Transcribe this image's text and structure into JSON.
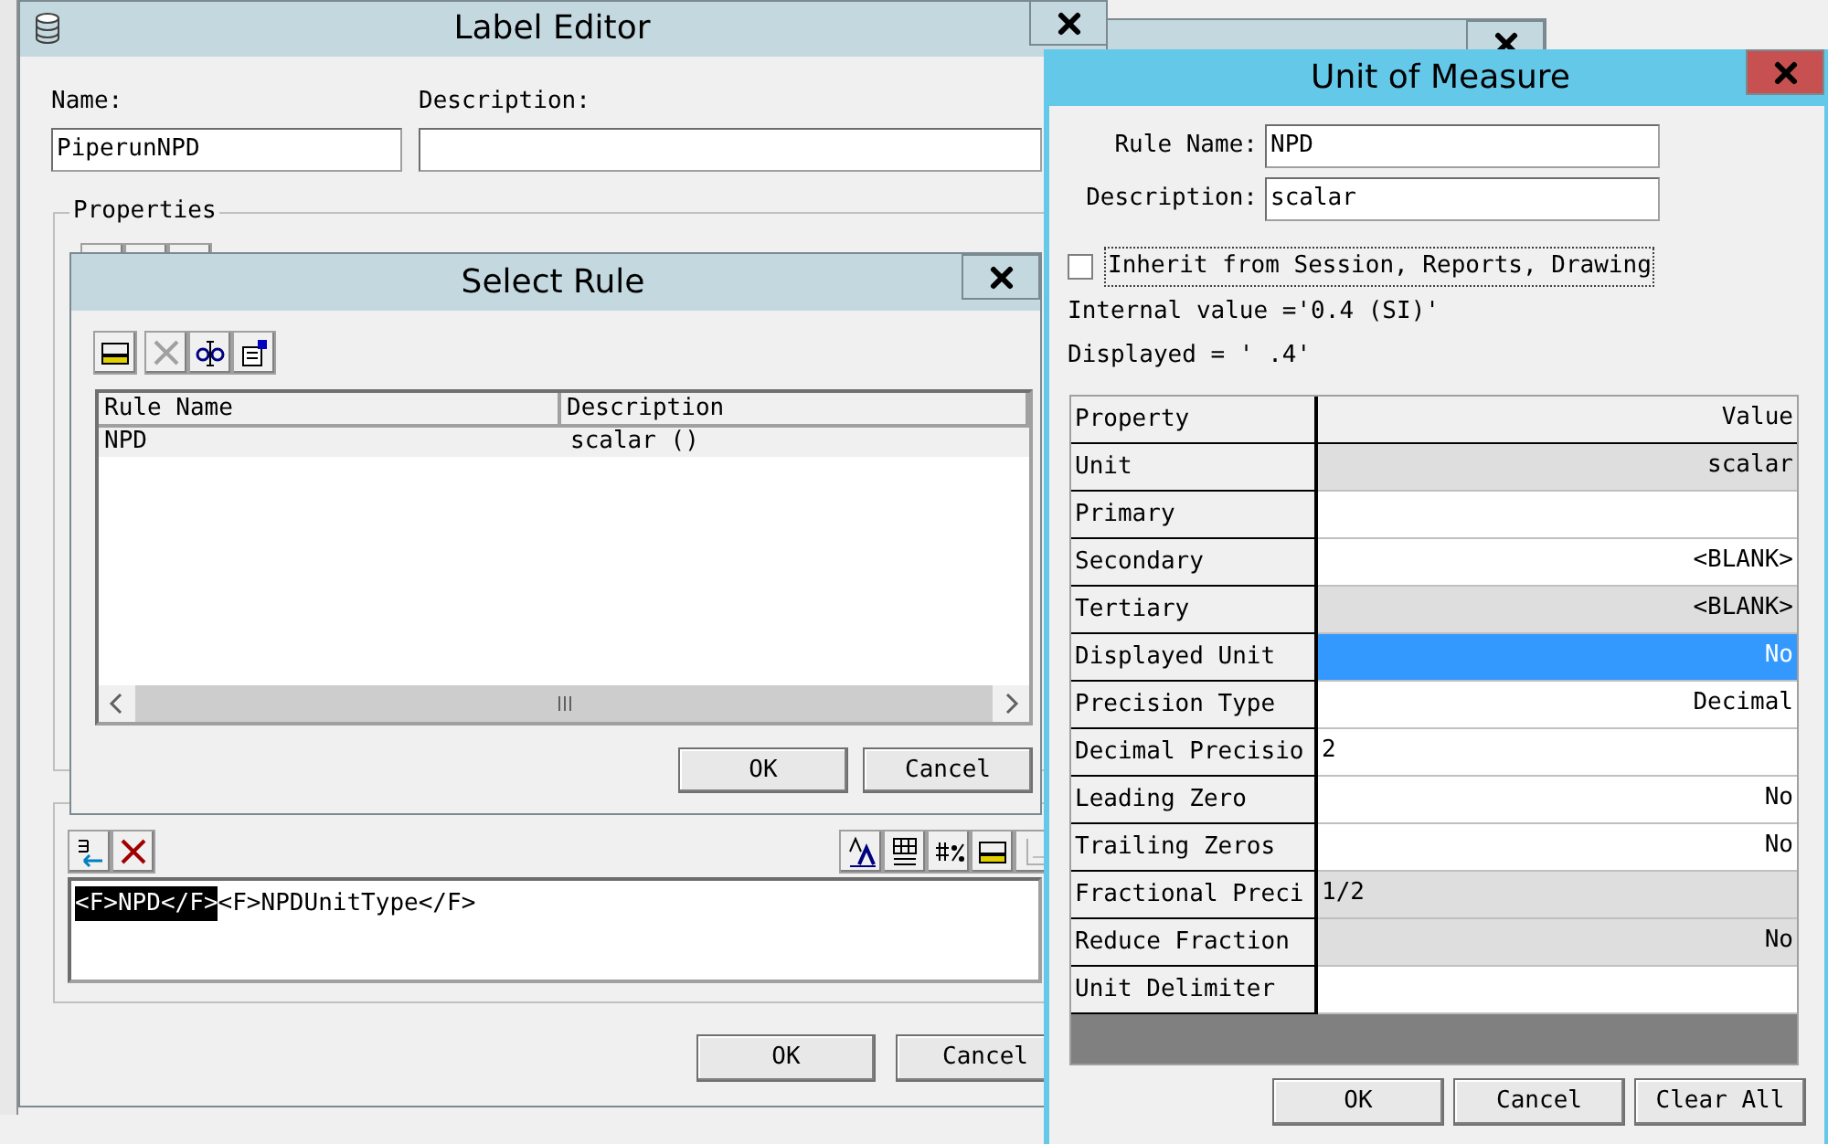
{
  "label_editor": {
    "title": "Label Editor",
    "name_label": "Name:",
    "name_value": "PiperunNPD",
    "description_label": "Description:",
    "properties_label": "Properties",
    "format_segments": [
      {
        "text": "<F>NPD</F>",
        "selected": true
      },
      {
        "text": "<F>NPDUnitType</F>",
        "selected": false
      }
    ],
    "buttons": [
      "OK",
      "Cancel"
    ]
  },
  "select_rule": {
    "title": "Select Rule",
    "columns": [
      "Rule Name",
      "Description"
    ],
    "rows": [
      {
        "cells": [
          "NPD",
          "scalar ()"
        ],
        "selected": true
      }
    ],
    "buttons": [
      "OK",
      "Cancel"
    ]
  },
  "unit_of_measure": {
    "title": "Unit of Measure",
    "rule_name_label": "Rule Name:",
    "rule_name_value": "NPD",
    "description_label": "Description:",
    "description_value": "scalar",
    "inherit": {
      "label": "Inherit from Session, Reports, Drawing",
      "checked": false
    },
    "internal_value": "Internal value ='0.4 (SI)'",
    "displayed": "Displayed = ' .4'",
    "columns": [
      "Property",
      "Value"
    ],
    "rows": [
      {
        "property": "Unit",
        "value": "scalar",
        "kind": "choice",
        "editable": false,
        "selected": false
      },
      {
        "property": "Primary",
        "kind": "choice",
        "editable": true,
        "selected": false
      },
      {
        "property": "Secondary",
        "value": "<BLANK>",
        "kind": "choice",
        "editable": true,
        "selected": false
      },
      {
        "property": "Tertiary",
        "value": "<BLANK>",
        "kind": "choice",
        "editable": false,
        "selected": false
      },
      {
        "property": "Displayed Unit",
        "value": "No",
        "kind": "choice",
        "selected": true
      },
      {
        "property": "Precision Type",
        "value": "Decimal",
        "kind": "choice",
        "editable": true,
        "selected": false
      },
      {
        "property": "Decimal Precisio",
        "value": "2",
        "kind": "number",
        "editable": true,
        "selected": false
      },
      {
        "property": "Leading Zero",
        "value": "No",
        "kind": "choice",
        "editable": true,
        "selected": false
      },
      {
        "property": "Trailing Zeros",
        "value": "No",
        "kind": "choice",
        "editable": true,
        "selected": false
      },
      {
        "property": "Fractional Preci",
        "value": "1/2",
        "kind": "number",
        "editable": false,
        "selected": false
      },
      {
        "property": "Reduce Fraction",
        "value": "No",
        "kind": "choice",
        "editable": false,
        "selected": false
      },
      {
        "property": "Unit Delimiter",
        "kind": "choice",
        "editable": true,
        "selected": false
      }
    ],
    "buttons": [
      "OK",
      "Cancel",
      "Clear All"
    ]
  }
}
